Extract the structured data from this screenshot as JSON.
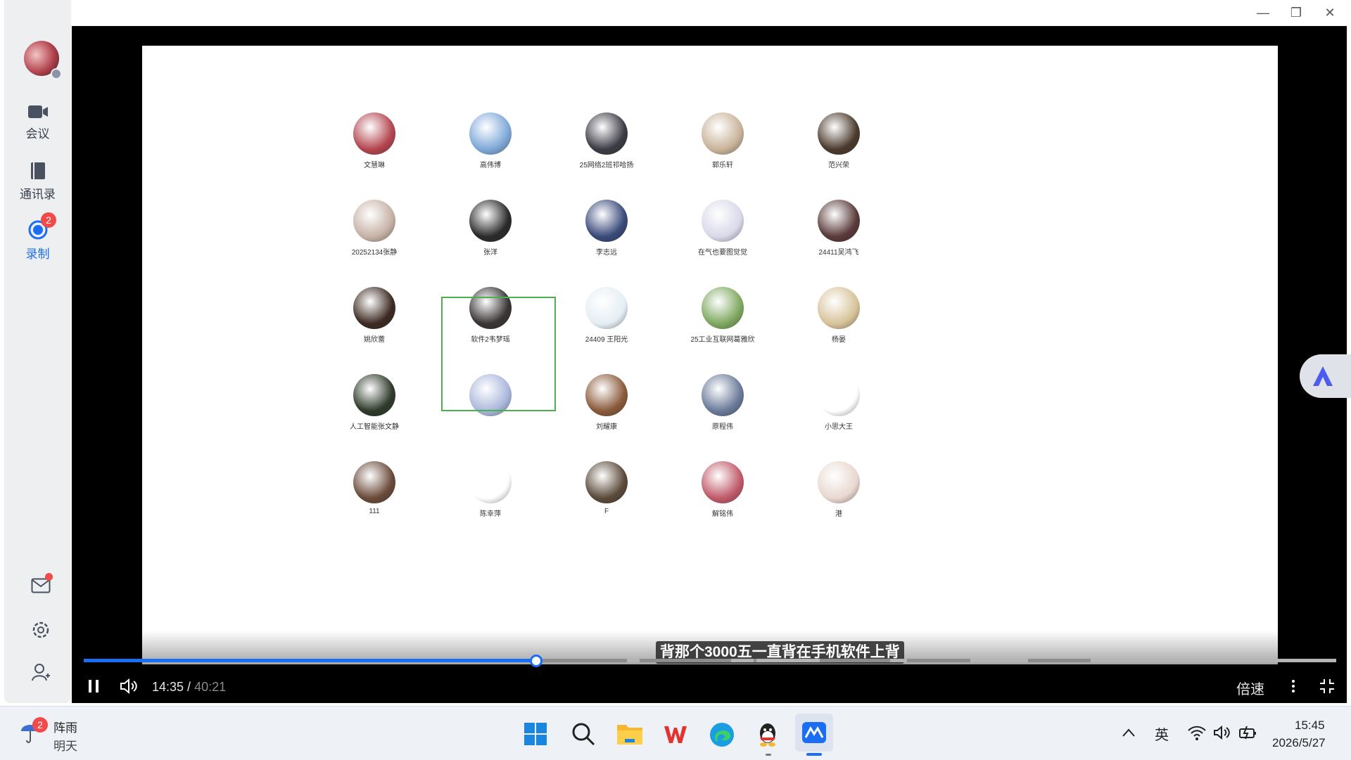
{
  "sidebar": {
    "items": [
      {
        "label": "会议",
        "icon": "video-camera-icon"
      },
      {
        "label": "通讯录",
        "icon": "contacts-book-icon"
      },
      {
        "label": "录制",
        "icon": "record-icon",
        "badge": "2"
      }
    ],
    "bottom_icons": [
      "mail-icon",
      "settings-icon",
      "user-switch-icon"
    ]
  },
  "window_controls": {
    "minimize": "—",
    "restore": "❐",
    "close": "✕"
  },
  "participants": [
    {
      "name": "文慧琳",
      "color": "#b3454f"
    },
    {
      "name": "高伟博",
      "color": "#7fa8d8"
    },
    {
      "name": "25网络2班祁哈扬",
      "color": "#3b3b45"
    },
    {
      "name": "郭乐轩",
      "color": "#c9b39a"
    },
    {
      "name": "范兴荣",
      "color": "#4b3a2c"
    },
    {
      "name": "20252134张静",
      "color": "#c7b2a6"
    },
    {
      "name": "张洋",
      "color": "#2b2b2b"
    },
    {
      "name": "李志远",
      "color": "#3a4a7a"
    },
    {
      "name": "在气也要图觉觉",
      "color": "#d9d9ea"
    },
    {
      "name": "24411吴鸿飞",
      "color": "#5a3a3a"
    },
    {
      "name": "姚欣蕾",
      "color": "#3d2a22"
    },
    {
      "name": "软件2韦梦瑶",
      "color": "#3a3535"
    },
    {
      "name": "24409 王阳光",
      "color": "#e4eef4"
    },
    {
      "name": "25工业互联网葛雅欣",
      "color": "#7fa860"
    },
    {
      "name": "杨晏",
      "color": "#d8c39a"
    },
    {
      "name": "人工智能张文静",
      "color": "#2e3a2a"
    },
    {
      "name": "",
      "color": "#aab8dc"
    },
    {
      "name": "刘耀康",
      "color": "#8a5a3a"
    },
    {
      "name": "原程伟",
      "color": "#6a7a9a"
    },
    {
      "name": "小思大王",
      "color": "#ffffff"
    },
    {
      "name": "111",
      "color": "#6a4a3a"
    },
    {
      "name": "陈幸萍",
      "color": "#ffffff"
    },
    {
      "name": "F",
      "color": "#5a4a3a"
    },
    {
      "name": "解铭伟",
      "color": "#c05a6a"
    },
    {
      "name": "港",
      "color": "#e8d8d0"
    }
  ],
  "subtitle": "背那个3000五一直背在手机软件上背",
  "player": {
    "current_time": "14:35",
    "separator": " / ",
    "total_time": "40:21",
    "progress": 0.3614,
    "speed_label": "倍速"
  },
  "taskbar": {
    "weather_badge": "2",
    "weather_temp": "阵雨",
    "weather_day": "明天",
    "apps": [
      "windows-start-icon",
      "search-icon",
      "file-explorer-icon",
      "wps-icon",
      "edge-icon",
      "qq-icon",
      "tencent-meeting-icon"
    ],
    "ime": "英",
    "time": "15:45",
    "date": "2026/5/27"
  },
  "colors": {
    "accent": "#1b6ef3",
    "badge": "#f04a4a",
    "speaker_border": "#4caf50"
  }
}
